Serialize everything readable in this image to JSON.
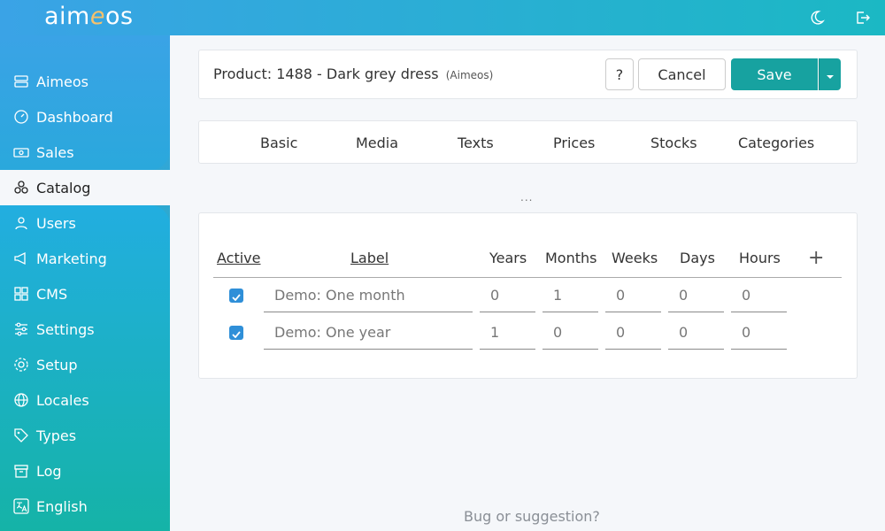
{
  "app": {
    "logo_prefix": "aim",
    "logo_e": "e",
    "logo_suffix": "os"
  },
  "sidebar": {
    "items": [
      {
        "label": "Aimeos",
        "icon": "server-icon"
      },
      {
        "label": "Dashboard",
        "icon": "gauge-icon"
      },
      {
        "label": "Sales",
        "icon": "cash-icon"
      },
      {
        "label": "Catalog",
        "icon": "boxes-icon"
      },
      {
        "label": "Users",
        "icon": "person-icon"
      },
      {
        "label": "Marketing",
        "icon": "megaphone-icon"
      },
      {
        "label": "CMS",
        "icon": "grid-icon"
      },
      {
        "label": "Settings",
        "icon": "sliders-icon"
      },
      {
        "label": "Setup",
        "icon": "gear-icon"
      },
      {
        "label": "Locales",
        "icon": "globe-icon"
      },
      {
        "label": "Types",
        "icon": "tags-icon"
      },
      {
        "label": "Log",
        "icon": "archive-icon"
      },
      {
        "label": "English",
        "icon": "translate-icon"
      }
    ],
    "active": "Catalog"
  },
  "header": {
    "title": "Product: 1488 - Dark grey dress",
    "site": "(Aimeos)",
    "help_label": "?",
    "cancel_label": "Cancel",
    "save_label": "Save"
  },
  "tabs": [
    "Basic",
    "Media",
    "Texts",
    "Prices",
    "Stocks",
    "Categories"
  ],
  "more": "...",
  "table": {
    "columns": [
      "Active",
      "Label",
      "Years",
      "Months",
      "Weeks",
      "Days",
      "Hours"
    ],
    "add_label": "+",
    "rows": [
      {
        "active": true,
        "label": "Demo: One month",
        "years": "0",
        "months": "1",
        "weeks": "0",
        "days": "0",
        "hours": "0"
      },
      {
        "active": true,
        "label": "Demo: One year",
        "years": "1",
        "months": "0",
        "weeks": "0",
        "days": "0",
        "hours": "0"
      }
    ]
  },
  "footer": {
    "link": "Bug or suggestion?"
  },
  "colors": {
    "accent": "#17a2a0",
    "gradient_start": "#3aa3e6",
    "gradient_end": "#15b3a7",
    "checkbox": "#2f8fd8"
  }
}
